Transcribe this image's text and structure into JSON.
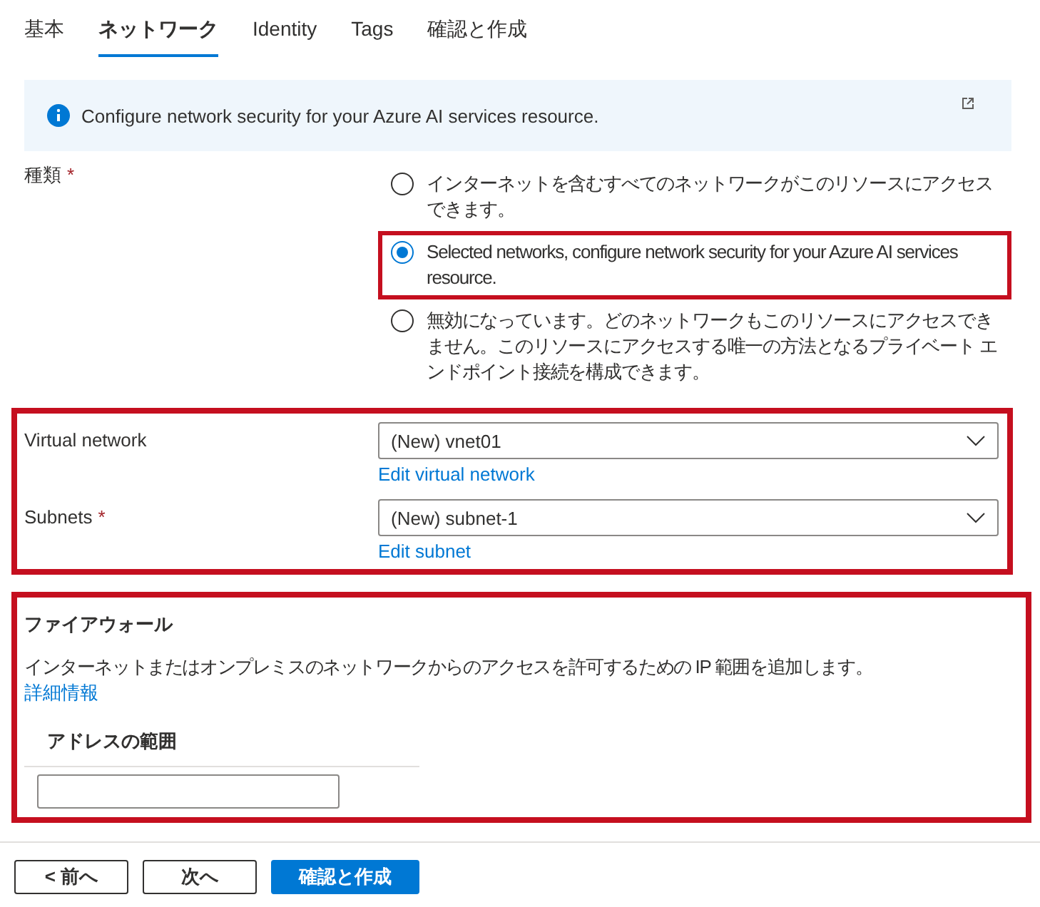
{
  "tabs": [
    {
      "label": "基本",
      "selected": false
    },
    {
      "label": "ネットワーク",
      "selected": true
    },
    {
      "label": "Identity",
      "selected": false
    },
    {
      "label": "Tags",
      "selected": false
    },
    {
      "label": "確認と作成",
      "selected": false
    }
  ],
  "info_banner": {
    "text": "Configure network security for your Azure AI services resource."
  },
  "access_type": {
    "label": "種類",
    "required_mark": "*",
    "options": [
      {
        "label": "インターネットを含むすべてのネットワークがこのリソースにアクセスできます。",
        "selected": false,
        "highlighted": false
      },
      {
        "label": "Selected networks, configure network security for your Azure AI services resource.",
        "selected": true,
        "highlighted": true
      },
      {
        "label": "無効になっています。どのネットワークもこのリソースにアクセスできません。このリソースにアクセスする唯一の方法となるプライベート エンドポイント接続を構成できます。",
        "selected": false,
        "highlighted": false
      }
    ]
  },
  "network_section": {
    "highlighted": true,
    "fields": [
      {
        "label": "Virtual network",
        "value": "(New) vnet01",
        "link": "Edit virtual network"
      },
      {
        "label": "Subnets",
        "required_mark": "*",
        "value": "(New) subnet-1",
        "link": "Edit subnet"
      }
    ]
  },
  "firewall": {
    "highlighted": true,
    "title": "ファイアウォール",
    "description": "インターネットまたはオンプレミスのネットワークからのアクセスを許可するための IP 範囲を追加します。",
    "link": "詳細情報",
    "column": "アドレスの範囲"
  },
  "buttons": [
    {
      "label": "< 前へ",
      "kind": "secondary"
    },
    {
      "label": "次へ",
      "kind": "secondary"
    },
    {
      "label": "確認と作成",
      "kind": "primary"
    }
  ]
}
